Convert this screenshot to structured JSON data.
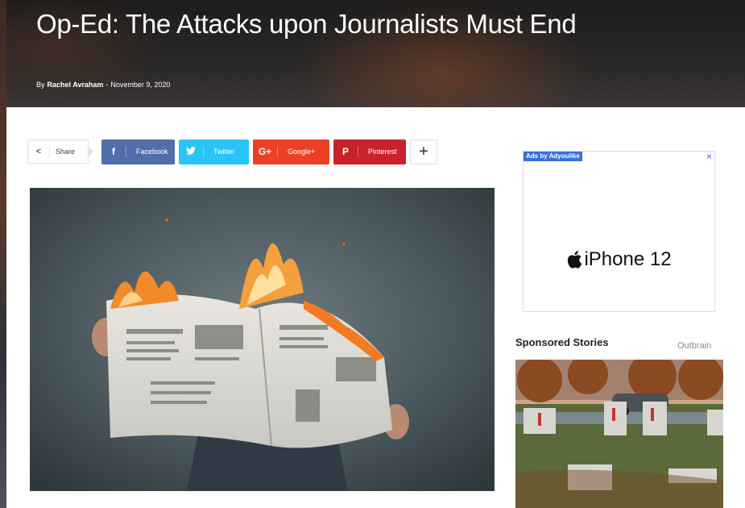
{
  "article": {
    "title": "Op-Ed: The Attacks upon Journalists Must End",
    "by_prefix": "By",
    "author": "Rachel Avraham",
    "separator": "-",
    "date": "November 9, 2020"
  },
  "share": {
    "label": "Share",
    "buttons": [
      {
        "name": "facebook",
        "label": "Facebook",
        "icon": "f",
        "color": "#516eab"
      },
      {
        "name": "twitter",
        "label": "Twitter",
        "icon": "twitter-bird",
        "color": "#29c5f6"
      },
      {
        "name": "googleplus",
        "label": "Google+",
        "icon": "G+",
        "color": "#eb4026"
      },
      {
        "name": "pinterest",
        "label": "Pinterest",
        "icon": "P",
        "color": "#ca212a"
      }
    ],
    "more_icon": "+"
  },
  "ad": {
    "label": "Ads by Adyoulike",
    "close": "×",
    "product": "iPhone 12"
  },
  "sponsored": {
    "title": "Sponsored Stories",
    "provider": "Outbrain"
  }
}
